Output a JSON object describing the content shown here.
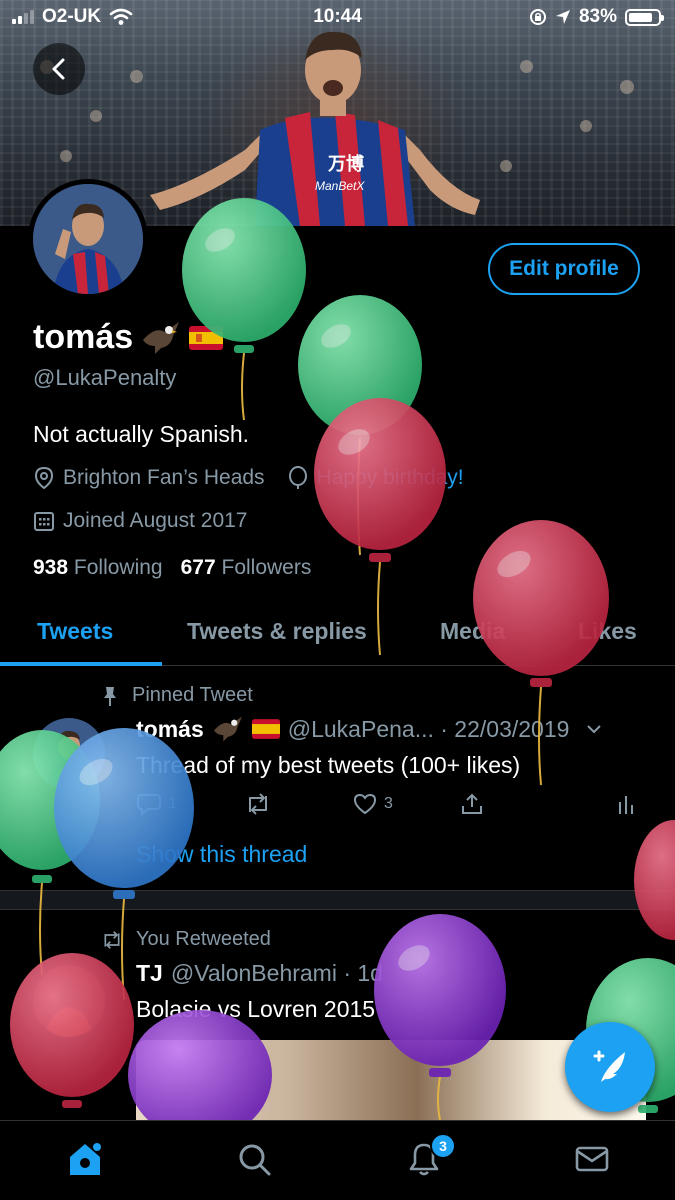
{
  "status_bar": {
    "carrier": "O2-UK",
    "time": "10:44",
    "battery": "83%",
    "battery_level": 0.83
  },
  "profile": {
    "name": "tomás",
    "name_emojis": [
      "eagle-emoji",
      "spain-flag-emoji"
    ],
    "handle": "@LukaPenalty",
    "bio": "Not actually Spanish.",
    "location": "Brighton Fan’s Heads",
    "website": "Happy birthday!",
    "joined": "Joined August 2017",
    "following_count": "938",
    "following_label": "Following",
    "followers_count": "677",
    "followers_label": "Followers",
    "edit_label": "Edit profile"
  },
  "tabs": [
    "Tweets",
    "Tweets & replies",
    "Media",
    "Likes"
  ],
  "tweets": {
    "pinned": {
      "pin_label": "Pinned Tweet",
      "name": "tomás",
      "handle_date": "@LukaPena... · 22/03/2019",
      "text": "Thread of my best tweets (100+ likes)",
      "reply_count": "1",
      "like_count": "3",
      "show_thread": "Show this thread"
    },
    "retweet": {
      "rt_label": "You Retweeted",
      "name": "TJ",
      "handle_date": "@ValonBehrami · 1d",
      "text": "Bolasie vs Lovren 2015"
    }
  },
  "tabbar": {
    "icons": [
      "home-icon",
      "search-icon",
      "notifications-icon",
      "messages-icon"
    ],
    "notifications_badge": "3"
  },
  "colors": {
    "accent": "#1da1f2",
    "secondary_text": "#8899a6",
    "background": "#000000",
    "balloon_green": "#4fcf8a",
    "balloon_red": "#d33d5c",
    "balloon_blue": "#4a90e2",
    "balloon_purple": "#8e35d6"
  }
}
